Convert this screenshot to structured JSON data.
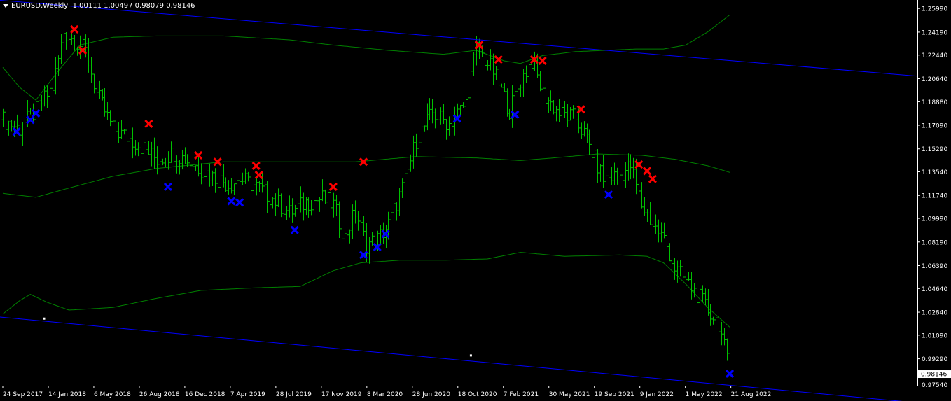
{
  "window": {
    "symbol_label": "EURUSD,Weekly",
    "ohlc_text": "1.00111 1.00497 0.98079 0.98146"
  },
  "colors": {
    "background": "#000000",
    "bars": "#00c000",
    "bands": "#008000",
    "channel": "#0000ff",
    "sell_marker": "#ff0000",
    "buy_marker": "#0000ff",
    "axis": "#ffffff"
  },
  "chart_data": {
    "type": "bar",
    "xlabel": "",
    "ylabel": "",
    "ylim": [
      0.9724,
      1.2664
    ],
    "y_ticks": [
      "1.25990",
      "1.24190",
      "1.22440",
      "1.20640",
      "1.18880",
      "1.17090",
      "1.15290",
      "1.13540",
      "1.11740",
      "1.09990",
      "1.08190",
      "1.06390",
      "1.04640",
      "1.02840",
      "1.01090",
      "0.99290"
    ],
    "y_tick_values": [
      1.2599,
      1.2419,
      1.2244,
      1.2064,
      1.1888,
      1.1709,
      1.1529,
      1.1354,
      1.1174,
      1.0999,
      1.0819,
      1.0639,
      1.0464,
      1.0284,
      1.0109,
      0.9929
    ],
    "y_bottom_label": "0.97540",
    "current_price": "0.98146",
    "x_ticks": [
      "24 Sep 2017",
      "14 Jan 2018",
      "6 May 2018",
      "26 Aug 2018",
      "16 Dec 2018",
      "7 Apr 2019",
      "28 Jul 2019",
      "17 Nov 2019",
      "8 Mar 2020",
      "28 Jun 2020",
      "18 Oct 2020",
      "7 Feb 2021",
      "30 May 2021",
      "19 Sep 2021",
      "9 Jan 2022",
      "1 May 2022",
      "21 Aug 2022"
    ],
    "bar_count": 265,
    "close_anchors": [
      [
        0,
        1.175
      ],
      [
        6,
        1.168
      ],
      [
        12,
        1.182
      ],
      [
        18,
        1.2
      ],
      [
        22,
        1.242
      ],
      [
        28,
        1.232
      ],
      [
        30,
        1.227
      ],
      [
        34,
        1.195
      ],
      [
        40,
        1.168
      ],
      [
        48,
        1.158
      ],
      [
        56,
        1.145
      ],
      [
        62,
        1.15
      ],
      [
        70,
        1.14
      ],
      [
        76,
        1.132
      ],
      [
        82,
        1.126
      ],
      [
        86,
        1.13
      ],
      [
        92,
        1.124
      ],
      [
        98,
        1.115
      ],
      [
        104,
        1.104
      ],
      [
        110,
        1.112
      ],
      [
        116,
        1.115
      ],
      [
        120,
        1.11
      ],
      [
        124,
        1.085
      ],
      [
        128,
        1.105
      ],
      [
        132,
        1.08
      ],
      [
        136,
        1.084
      ],
      [
        140,
        1.095
      ],
      [
        146,
        1.128
      ],
      [
        150,
        1.16
      ],
      [
        156,
        1.18
      ],
      [
        162,
        1.172
      ],
      [
        168,
        1.188
      ],
      [
        172,
        1.23
      ],
      [
        178,
        1.212
      ],
      [
        184,
        1.182
      ],
      [
        188,
        1.205
      ],
      [
        192,
        1.22
      ],
      [
        196,
        1.195
      ],
      [
        202,
        1.18
      ],
      [
        208,
        1.176
      ],
      [
        212,
        1.16
      ],
      [
        218,
        1.13
      ],
      [
        224,
        1.133
      ],
      [
        228,
        1.14
      ],
      [
        232,
        1.11
      ],
      [
        236,
        1.095
      ],
      [
        240,
        1.084
      ],
      [
        244,
        1.062
      ],
      [
        248,
        1.052
      ],
      [
        252,
        1.042
      ],
      [
        256,
        1.03
      ],
      [
        260,
        1.02
      ],
      [
        264,
        0.9815
      ]
    ],
    "series": [
      {
        "name": "",
        "style": "channel-upper",
        "points": [
          [
            0,
            1.266
          ],
          [
            264,
            1.2202
          ]
        ]
      },
      {
        "name": "",
        "style": "channel-lower",
        "points": [
          [
            0,
            1.0245
          ],
          [
            264,
            0.9727
          ]
        ]
      },
      {
        "name": "",
        "style": "band-upper",
        "points": [
          [
            0,
            1.215
          ],
          [
            6,
            1.2
          ],
          [
            12,
            1.19
          ],
          [
            20,
            1.212
          ],
          [
            28,
            1.232
          ],
          [
            40,
            1.238
          ],
          [
            56,
            1.239
          ],
          [
            80,
            1.239
          ],
          [
            104,
            1.236
          ],
          [
            120,
            1.232
          ],
          [
            140,
            1.228
          ],
          [
            160,
            1.225
          ],
          [
            172,
            1.228
          ],
          [
            182,
            1.22
          ],
          [
            188,
            1.218
          ],
          [
            196,
            1.224
          ],
          [
            208,
            1.227
          ],
          [
            230,
            1.229
          ],
          [
            240,
            1.229
          ],
          [
            248,
            1.232
          ],
          [
            256,
            1.242
          ],
          [
            264,
            1.255
          ]
        ]
      },
      {
        "name": "",
        "style": "band-mid",
        "points": [
          [
            0,
            1.119
          ],
          [
            12,
            1.116
          ],
          [
            24,
            1.123
          ],
          [
            40,
            1.132
          ],
          [
            56,
            1.138
          ],
          [
            80,
            1.143
          ],
          [
            104,
            1.143
          ],
          [
            128,
            1.143
          ],
          [
            150,
            1.147
          ],
          [
            172,
            1.146
          ],
          [
            188,
            1.144
          ],
          [
            200,
            1.146
          ],
          [
            216,
            1.149
          ],
          [
            232,
            1.148
          ],
          [
            244,
            1.145
          ],
          [
            256,
            1.14
          ],
          [
            264,
            1.135
          ]
        ]
      },
      {
        "name": "",
        "style": "band-lower",
        "points": [
          [
            0,
            1.027
          ],
          [
            6,
            1.037
          ],
          [
            10,
            1.042
          ],
          [
            16,
            1.036
          ],
          [
            24,
            1.03
          ],
          [
            40,
            1.032
          ],
          [
            56,
            1.039
          ],
          [
            72,
            1.045
          ],
          [
            92,
            1.047
          ],
          [
            108,
            1.048
          ],
          [
            120,
            1.06
          ],
          [
            130,
            1.066
          ],
          [
            144,
            1.068
          ],
          [
            160,
            1.068
          ],
          [
            176,
            1.069
          ],
          [
            188,
            1.074
          ],
          [
            204,
            1.071
          ],
          [
            224,
            1.072
          ],
          [
            234,
            1.071
          ],
          [
            240,
            1.066
          ],
          [
            248,
            1.05
          ],
          [
            256,
            1.032
          ],
          [
            264,
            1.017
          ]
        ]
      }
    ],
    "sell_markers": [
      [
        26,
        1.244
      ],
      [
        29,
        1.228
      ],
      [
        53,
        1.172
      ],
      [
        71,
        1.148
      ],
      [
        78,
        1.143
      ],
      [
        92,
        1.14
      ],
      [
        93,
        1.133
      ],
      [
        120,
        1.124
      ],
      [
        131,
        1.143
      ],
      [
        173,
        1.232
      ],
      [
        180,
        1.221
      ],
      [
        193,
        1.221
      ],
      [
        196,
        1.22
      ],
      [
        210,
        1.183
      ],
      [
        231,
        1.141
      ],
      [
        234,
        1.136
      ],
      [
        236,
        1.13
      ]
    ],
    "buy_markers": [
      [
        5,
        1.166
      ],
      [
        10,
        1.175
      ],
      [
        12,
        1.18
      ],
      [
        60,
        1.124
      ],
      [
        83,
        1.113
      ],
      [
        86,
        1.112
      ],
      [
        106,
        1.091
      ],
      [
        131,
        1.072
      ],
      [
        136,
        1.078
      ],
      [
        139,
        1.088
      ],
      [
        165,
        1.176
      ],
      [
        186,
        1.179
      ],
      [
        220,
        1.118
      ],
      [
        264,
        0.9815
      ]
    ],
    "small_points": [
      [
        15,
        1.0235
      ],
      [
        170,
        0.9954
      ]
    ]
  }
}
